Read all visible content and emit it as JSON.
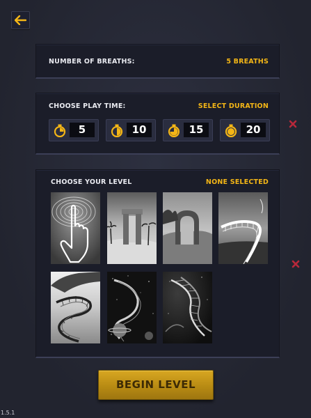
{
  "breaths": {
    "label": "NUMBER OF BREATHS:",
    "value": "5 BREATHS"
  },
  "play_time": {
    "label": "CHOOSE PLAY TIME:",
    "value": "SELECT DURATION",
    "durations": [
      "5",
      "10",
      "15",
      "20"
    ]
  },
  "level": {
    "label": "CHOOSE YOUR LEVEL",
    "value": "NONE SELECTED",
    "thumbnails": [
      "finger-touch",
      "desert-gate",
      "stone-arch",
      "spiral-staircase",
      "tower-staircase",
      "space-staircase",
      "dna-helix"
    ]
  },
  "begin_label": "BEGIN LEVEL",
  "version": "1.5.1",
  "colors": {
    "accent": "#f4b616",
    "panel": "#1b1d29",
    "background": "#262836",
    "button": "#c89a1c",
    "close": "#b8283a"
  }
}
